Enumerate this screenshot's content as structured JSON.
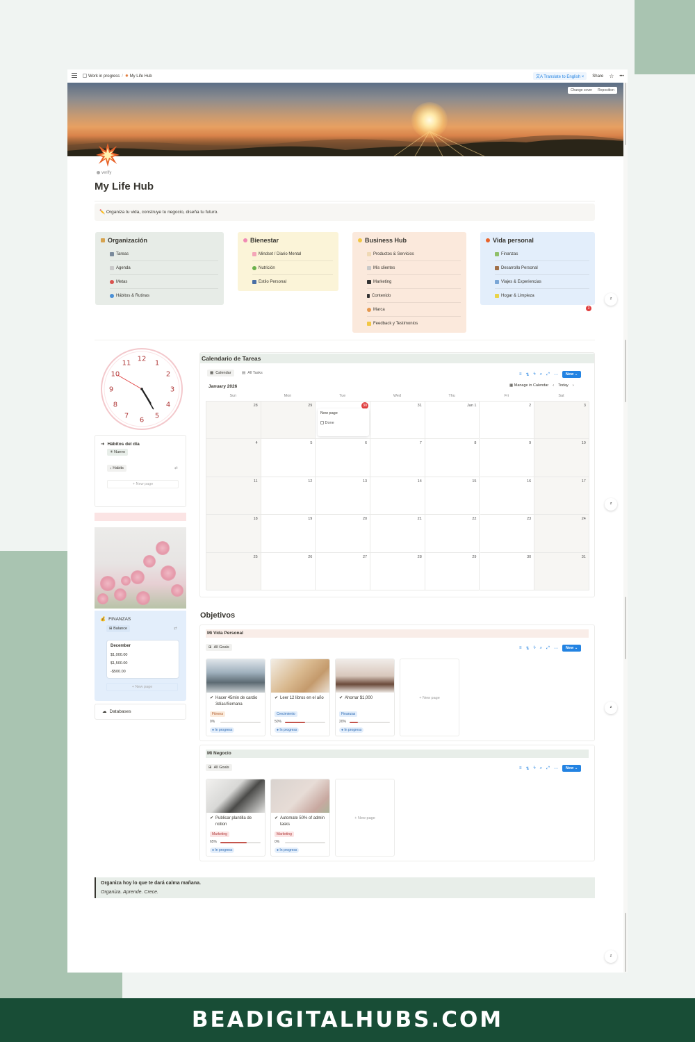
{
  "breadcrumb": {
    "workspace": "Work in progress",
    "page": "My Life Hub"
  },
  "topbar": {
    "translate": "Translate to English",
    "share": "Share"
  },
  "cover": {
    "change_cover": "Change cover",
    "reposition": "Reposition"
  },
  "page": {
    "verify": "verify",
    "title": "My Life Hub",
    "callout": "Organiza tu vida, construye tu negocio, diseña tu futuro."
  },
  "hubs": [
    {
      "title": "Organización",
      "items": [
        "Tareas",
        "Agenda",
        "Metas",
        "Hábitos & Rutinas"
      ]
    },
    {
      "title": "Bienestar",
      "items": [
        "Mindset / Diario Mental",
        "Nutrición",
        "Estilo Personal"
      ]
    },
    {
      "title": "Business Hub",
      "items": [
        "Productos & Servicios",
        "Mis clientes",
        "Marketing",
        "Contenido",
        "Marca",
        "Feedback y Testimonios"
      ]
    },
    {
      "title": "Vida personal",
      "items": [
        "Finanzas",
        "Desarrollo Personal",
        "Viajes & Experiencias",
        "Hogar & Limpieza"
      ]
    }
  ],
  "notification_count": "3",
  "clock": {
    "numbers": [
      "12",
      "1",
      "2",
      "3",
      "4",
      "5",
      "6",
      "7",
      "8",
      "9",
      "10",
      "11"
    ],
    "hour": 4.95,
    "minute": 25,
    "second": 50
  },
  "habits": {
    "title": "Hábitos del día",
    "new_chip": "Nuevo",
    "view": "Habits",
    "new_page": "New page"
  },
  "finanzas": {
    "title": "FINANZAS",
    "view": "Balance",
    "card_title": "December",
    "values": [
      "$1,000.00",
      "$1,500.00",
      "-$500.00"
    ],
    "new_page": "New page"
  },
  "databases": "Databases",
  "calendar": {
    "title": "Calendario de Tareas",
    "view_calendar": "Calendar",
    "view_all": "All Tasks",
    "new": "New",
    "month": "January 2026",
    "manage": "Manage in Calendar",
    "today": "Today",
    "days": [
      "Sun",
      "Mon",
      "Tue",
      "Wed",
      "Thu",
      "Fri",
      "Sat"
    ],
    "dates": [
      "28",
      "29",
      "30",
      "31",
      "Jan 1",
      "2",
      "3",
      "4",
      "5",
      "6",
      "7",
      "8",
      "9",
      "10",
      "11",
      "12",
      "13",
      "14",
      "15",
      "16",
      "17",
      "18",
      "19",
      "20",
      "21",
      "22",
      "23",
      "24",
      "25",
      "26",
      "27",
      "28",
      "29",
      "30",
      "31"
    ],
    "event_title": "New page",
    "event_check": "Done"
  },
  "objetivos": {
    "title": "Objetivos",
    "personal": {
      "title": "Mi Vida Personal",
      "view": "All Goals",
      "new": "New",
      "new_page": "New page",
      "cards": [
        {
          "title": "Hacer 45min de cardio 3días/Semana",
          "tag": "Fitness",
          "pct": "0%",
          "progress": 0,
          "status": "In progress"
        },
        {
          "title": "Leer 12 libros en el año",
          "tag": "Crecimiento",
          "pct": "50%",
          "progress": 50,
          "status": "In progress"
        },
        {
          "title": "Ahorrar $1,000",
          "tag": "Finanzas",
          "pct": "20%",
          "progress": 20,
          "status": "In progress"
        }
      ]
    },
    "negocio": {
      "title": "Mi Negocio",
      "view": "All Goals",
      "new": "New",
      "new_page": "New page",
      "cards": [
        {
          "title": "Publicar plantilla de notion",
          "tag": "Marketing",
          "pct": "65%",
          "progress": 65,
          "status": "In progress"
        },
        {
          "title": "Automate 50% of admin tasks",
          "tag": "Marketing",
          "pct": "0%",
          "progress": 0,
          "status": "In progress"
        }
      ]
    }
  },
  "quote": {
    "line1": "Organiza hoy lo que te dará calma mañana.",
    "line2": "Organiza. Aprende. Crece."
  },
  "footer": "BEADIGITALHUBS.COM",
  "colors": {
    "accent": "#2383e2",
    "brand_green": "#184d36",
    "sage": "#a9c4b1",
    "today_red": "#e03e3e"
  }
}
